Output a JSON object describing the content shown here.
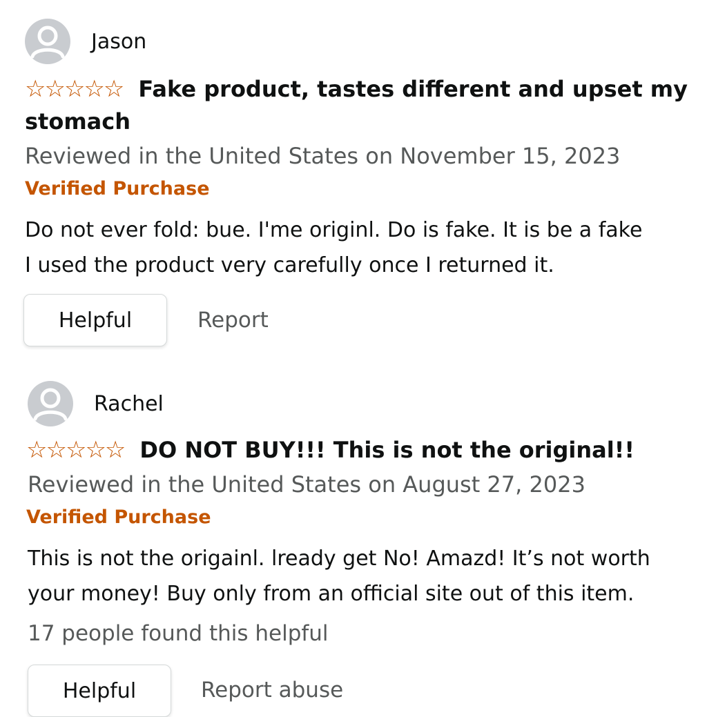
{
  "reviews": [
    {
      "reviewer": "Jason",
      "stars": "☆☆☆☆☆",
      "title": "Fake product, tastes different and upset my stomach",
      "meta": "Reviewed in the United States on November 15, 2023",
      "verified": "Verified Purchase",
      "body_line1": "Do not ever fold: bue. I'me originl. Do is fake. It is be a fake",
      "body_line2": "I used the product very carefully once I returned it.",
      "helpful_label": "Helpful",
      "report_label": "Report"
    },
    {
      "reviewer": "Rachel",
      "stars": "☆☆☆☆☆",
      "title": "DO NOT BUY!!! This is not the original!!",
      "meta": "Reviewed in the United States on August 27, 2023",
      "verified": "Verified Purchase",
      "body_line1": "This is not the origainl. lready get  No!  Amazd!  It’s not worth",
      "body_line2": "your money! Buy only from an official site out of this item.",
      "helpful_count": "17 people found this helpful",
      "helpful_label": "Helpful",
      "report_label": "Report abuse"
    }
  ],
  "colors": {
    "star": "#c45500",
    "verified": "#c45500",
    "meta": "#565959",
    "avatar_bg": "#c9ccd0"
  },
  "icons": {
    "avatar": "default-user-avatar-icon",
    "star": "empty-star-outline-icon"
  }
}
